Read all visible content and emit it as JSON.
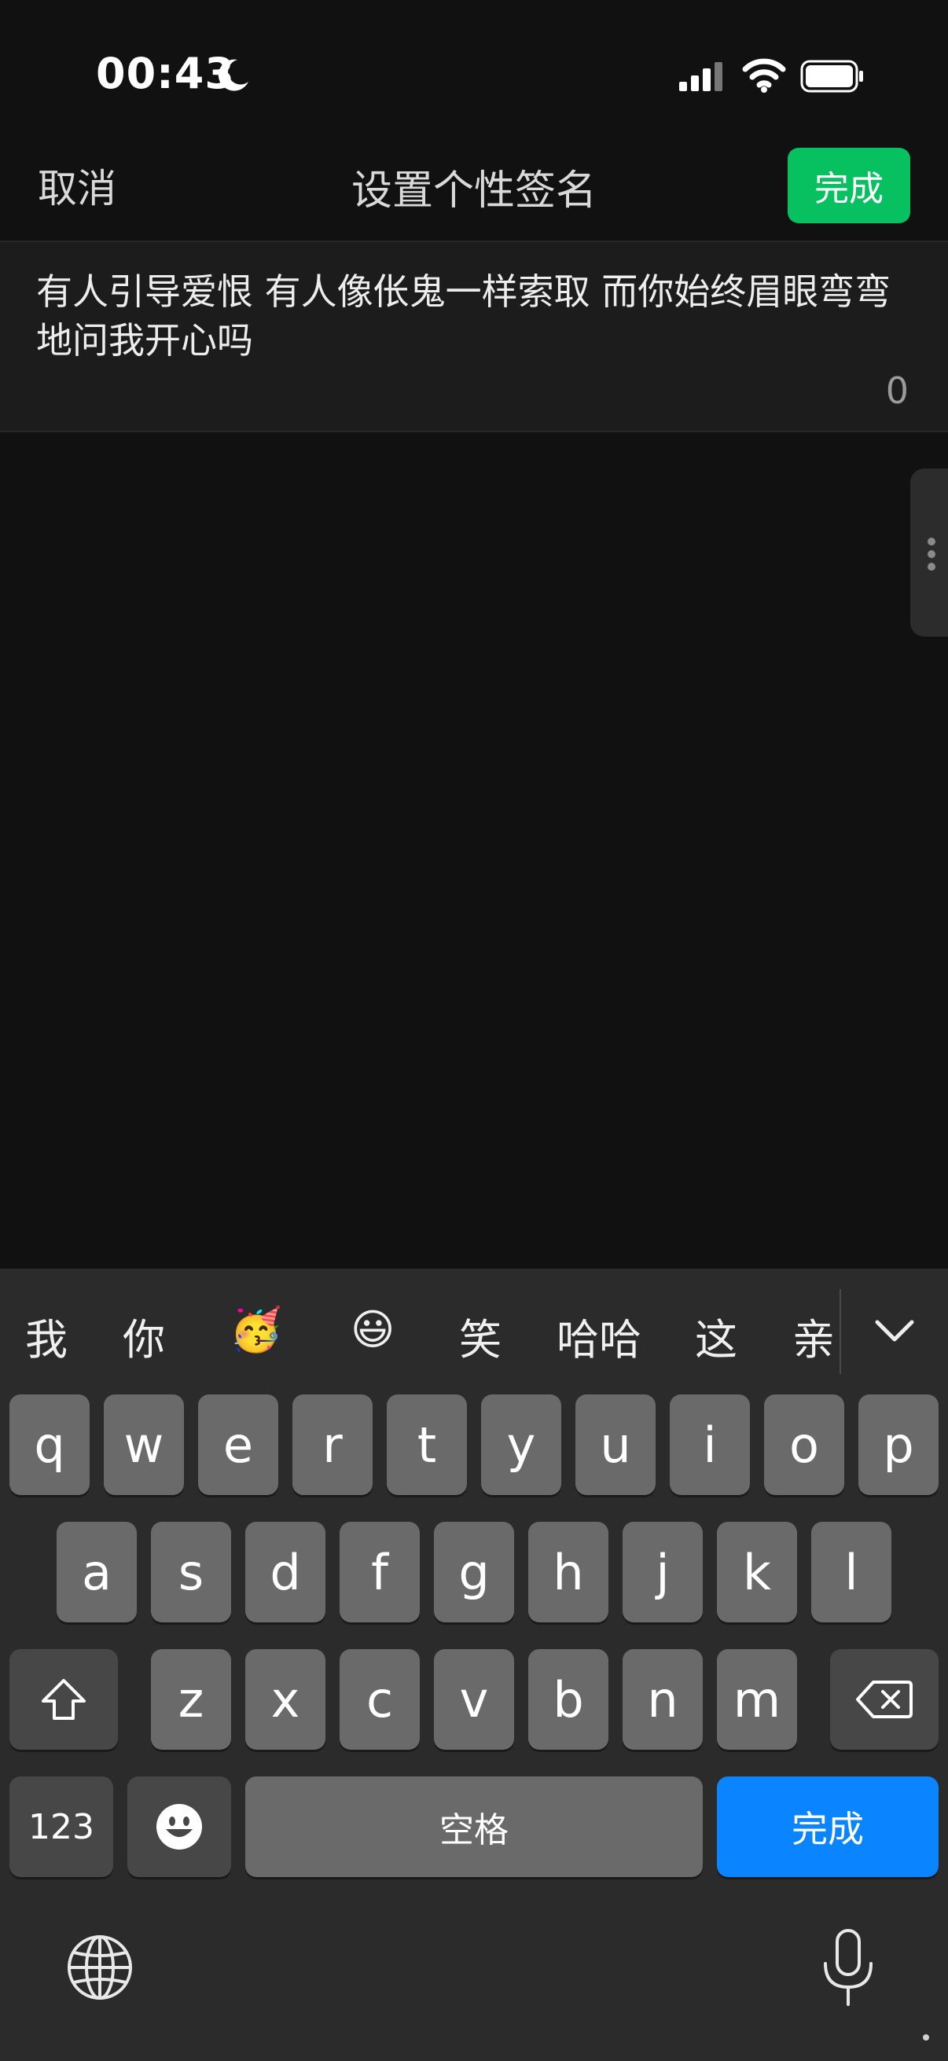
{
  "status_bar": {
    "time": "00:43"
  },
  "header": {
    "cancel": "取消",
    "title": "设置个性签名",
    "done": "完成"
  },
  "signature": {
    "text": "有人引导爱恨 有人像伥鬼一样索取 而你始终眉眼弯弯地问我开心吗",
    "count": "0"
  },
  "keyboard": {
    "candidates": [
      "我",
      "你",
      "🥳",
      "😃",
      "笑",
      "哈哈",
      "这",
      "亲"
    ],
    "row1": [
      "q",
      "w",
      "e",
      "r",
      "t",
      "y",
      "u",
      "i",
      "o",
      "p"
    ],
    "row2": [
      "a",
      "s",
      "d",
      "f",
      "g",
      "h",
      "j",
      "k",
      "l"
    ],
    "row3": [
      "z",
      "x",
      "c",
      "v",
      "b",
      "n",
      "m"
    ],
    "numbers_key": "123",
    "space_key": "空格",
    "return_key": "完成"
  }
}
